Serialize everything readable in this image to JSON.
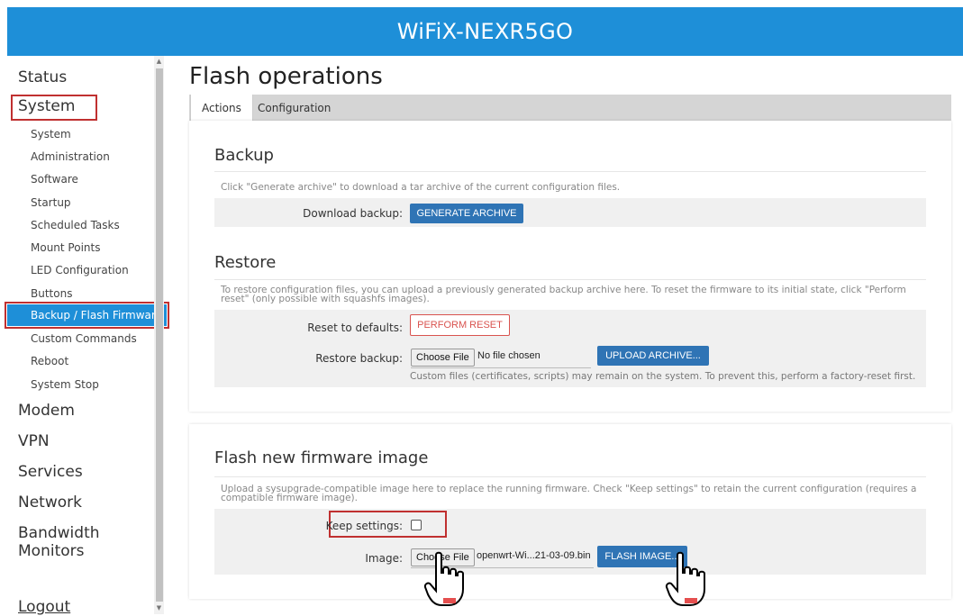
{
  "header": {
    "title": "WiFiX-NEXR5GO"
  },
  "sidebar": {
    "main_items": [
      "Status",
      "System",
      "Modem",
      "VPN",
      "Services",
      "Network",
      "Bandwidth",
      "Monitors"
    ],
    "sub_items": [
      "System",
      "Administration",
      "Software",
      "Startup",
      "Scheduled Tasks",
      "Mount Points",
      "LED Configuration",
      "Buttons",
      "Backup / Flash Firmware",
      "Custom Commands",
      "Reboot",
      "System Stop"
    ],
    "logout": "Logout"
  },
  "page": {
    "title": "Flash operations",
    "tabs": [
      "Actions",
      "Configuration"
    ]
  },
  "backup": {
    "title": "Backup",
    "desc": "Click \"Generate archive\" to download a tar archive of the current configuration files.",
    "label": "Download backup:",
    "button": "GENERATE ARCHIVE"
  },
  "restore": {
    "title": "Restore",
    "desc_line1": "To restore configuration files, you can upload a previously generated backup archive here. To reset the firmware to its initial state, click \"Perform",
    "desc_line2": "reset\" (only possible with squashfs images).",
    "reset_label": "Reset to defaults:",
    "reset_button": "PERFORM RESET",
    "restore_label": "Restore backup:",
    "choose_file": "Choose File",
    "no_file": "No file chosen",
    "upload_button": "UPLOAD ARCHIVE...",
    "hint": "Custom files (certificates, scripts) may remain on the system. To prevent this, perform a factory-reset first."
  },
  "flash": {
    "title": "Flash new firmware image",
    "desc_line1": "Upload a sysupgrade-compatible image here to replace the running firmware. Check \"Keep settings\" to retain the current configuration (requires a",
    "desc_line2": "compatible firmware image).",
    "keep_label": "Keep settings:",
    "image_label": "Image:",
    "choose_file": "Choose File",
    "file_name": "openwrt-Wi...21-03-09.bin",
    "flash_button": "FLASH IMAGE..."
  },
  "colors": {
    "header": "#1e8fd8",
    "button": "#2f74b5",
    "danger": "#d9534f",
    "highlight": "#c03030"
  },
  "icons": [
    "hand-pointer-icon",
    "hand-pointer-icon"
  ]
}
